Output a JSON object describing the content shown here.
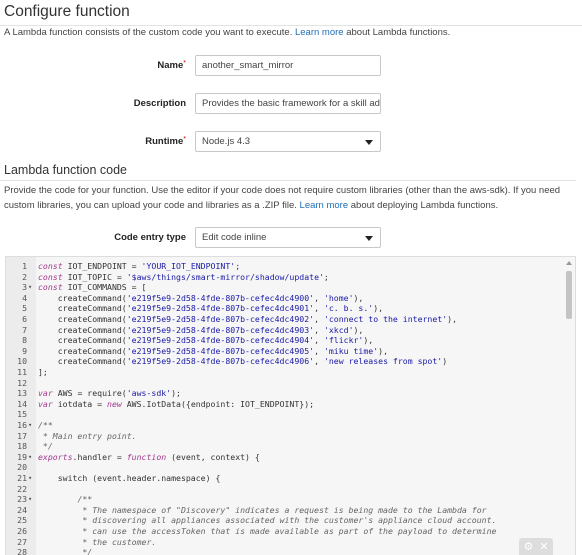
{
  "header": {
    "title": "Configure function",
    "intro_prefix": "A Lambda function consists of the custom code you want to execute.",
    "intro_link": "Learn more",
    "intro_suffix": "about Lambda functions."
  },
  "form": {
    "name_label": "Name",
    "name_value": "another_smart_mirror",
    "description_label": "Description",
    "description_value": "Provides the basic framework for a skill ada",
    "runtime_label": "Runtime",
    "runtime_value": "Node.js 4.3",
    "required_mark": "*"
  },
  "code_section": {
    "title": "Lambda function code",
    "desc_prefix": "Provide the code for your function. Use the editor if your code does not require custom libraries (other than the aws-sdk). If you need custom libraries, you can upload your code and libraries as a .ZIP file.",
    "desc_link": "Learn more",
    "desc_suffix": "about deploying Lambda functions.",
    "entry_label": "Code entry type",
    "entry_value": "Edit code inline"
  },
  "editor": {
    "lines": [
      {
        "n": "1",
        "fold": "",
        "html": "<span class=\"kw\">const</span> IOT_ENDPOINT = <span class=\"str\">'YOUR_IOT_ENDPOINT'</span>;"
      },
      {
        "n": "2",
        "fold": "",
        "html": "<span class=\"kw\">const</span> IOT_TOPIC = <span class=\"str\">'$aws/things/smart-mirror/shadow/update'</span>;"
      },
      {
        "n": "3",
        "fold": "▾",
        "html": "<span class=\"kw\">const</span> IOT_COMMANDS = ["
      },
      {
        "n": "4",
        "fold": "",
        "html": "    createCommand(<span class=\"str\">'e219f5e9-2d58-4fde-807b-cefec4dc4900'</span>, <span class=\"str\">'home'</span>),"
      },
      {
        "n": "5",
        "fold": "",
        "html": "    createCommand(<span class=\"str\">'e219f5e9-2d58-4fde-807b-cefec4dc4901'</span>, <span class=\"str\">'c. b. s.'</span>),"
      },
      {
        "n": "6",
        "fold": "",
        "html": "    createCommand(<span class=\"str\">'e219f5e9-2d58-4fde-807b-cefec4dc4902'</span>, <span class=\"str\">'connect to the internet'</span>),"
      },
      {
        "n": "7",
        "fold": "",
        "html": "    createCommand(<span class=\"str\">'e219f5e9-2d58-4fde-807b-cefec4dc4903'</span>, <span class=\"str\">'xkcd'</span>),"
      },
      {
        "n": "8",
        "fold": "",
        "html": "    createCommand(<span class=\"str\">'e219f5e9-2d58-4fde-807b-cefec4dc4904'</span>, <span class=\"str\">'flickr'</span>),"
      },
      {
        "n": "9",
        "fold": "",
        "html": "    createCommand(<span class=\"str\">'e219f5e9-2d58-4fde-807b-cefec4dc4905'</span>, <span class=\"str\">'miku time'</span>),"
      },
      {
        "n": "10",
        "fold": "",
        "html": "    createCommand(<span class=\"str\">'e219f5e9-2d58-4fde-807b-cefec4dc4906'</span>, <span class=\"str\">'new releases from spot'</span>)"
      },
      {
        "n": "11",
        "fold": "",
        "html": "];"
      },
      {
        "n": "12",
        "fold": "",
        "html": ""
      },
      {
        "n": "13",
        "fold": "",
        "html": "<span class=\"kw\">var</span> AWS = require(<span class=\"str\">'aws-sdk'</span>);"
      },
      {
        "n": "14",
        "fold": "",
        "html": "<span class=\"kw\">var</span> iotdata = <span class=\"kw\">new</span> AWS.IotData({endpoint: IOT_ENDPOINT});"
      },
      {
        "n": "15",
        "fold": "",
        "html": ""
      },
      {
        "n": "16",
        "fold": "▾",
        "html": "<span class=\"cmt\">/**</span>"
      },
      {
        "n": "17",
        "fold": "",
        "html": "<span class=\"cmt\"> * Main entry point.</span>"
      },
      {
        "n": "18",
        "fold": "",
        "html": "<span class=\"cmt\"> */</span>"
      },
      {
        "n": "19",
        "fold": "▾",
        "html": "<span class=\"kw\">exports</span>.handler = <span class=\"fn\">function</span> (event, context) {"
      },
      {
        "n": "20",
        "fold": "",
        "html": ""
      },
      {
        "n": "21",
        "fold": "▾",
        "html": "    switch (event.header.namespace) {"
      },
      {
        "n": "22",
        "fold": "",
        "html": ""
      },
      {
        "n": "23",
        "fold": "▾",
        "html": "        <span class=\"cmt\">/**</span>"
      },
      {
        "n": "24",
        "fold": "",
        "html": "<span class=\"cmt\">         * The namespace of \"Discovery\" indicates a request is being made to the Lambda for</span>"
      },
      {
        "n": "25",
        "fold": "",
        "html": "<span class=\"cmt\">         * discovering all appliances associated with the customer's appliance cloud account.</span>"
      },
      {
        "n": "26",
        "fold": "",
        "html": "<span class=\"cmt\">         * can use the accessToken that is made available as part of the payload to determine</span>"
      },
      {
        "n": "27",
        "fold": "",
        "html": "<span class=\"cmt\">         * the customer.</span>"
      },
      {
        "n": "28",
        "fold": "",
        "html": "<span class=\"cmt\">         */</span>"
      }
    ]
  }
}
